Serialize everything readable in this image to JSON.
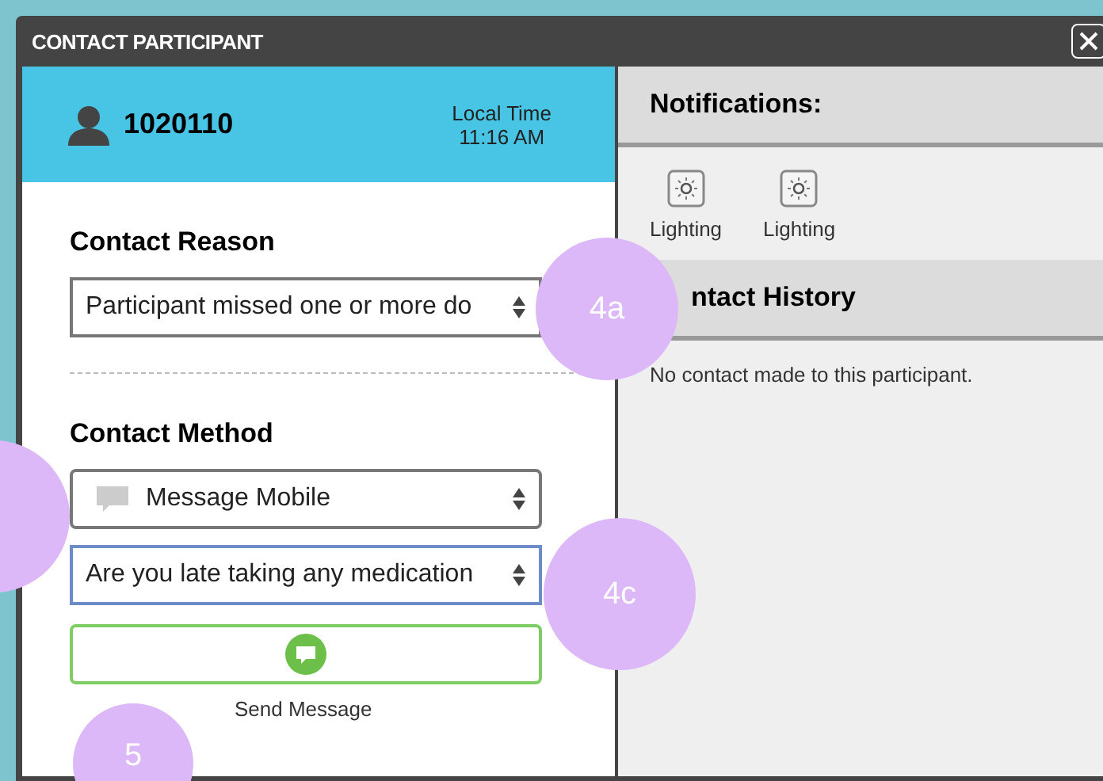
{
  "window": {
    "title": "CONTACT PARTICIPANT"
  },
  "participant": {
    "id": "1020110",
    "time_label": "Local Time",
    "time": "11:16 AM"
  },
  "contact_reason": {
    "label": "Contact Reason",
    "value": "Participant missed one or more do"
  },
  "contact_method": {
    "label": "Contact Method",
    "method": "Message Mobile",
    "message": "Are you late taking any medication",
    "send_label": "Send Message"
  },
  "notifications": {
    "title": "Notifications:",
    "items": [
      {
        "label": "Lighting"
      },
      {
        "label": "Lighting"
      }
    ]
  },
  "contact_history": {
    "title": "ntact History",
    "empty": "No contact made to this participant."
  },
  "callouts": [
    {
      "label": "4a",
      "kind": "full"
    },
    {
      "kind": "edge"
    },
    {
      "label": "4c",
      "kind": "full"
    },
    {
      "label": "5",
      "kind": "full"
    }
  ]
}
